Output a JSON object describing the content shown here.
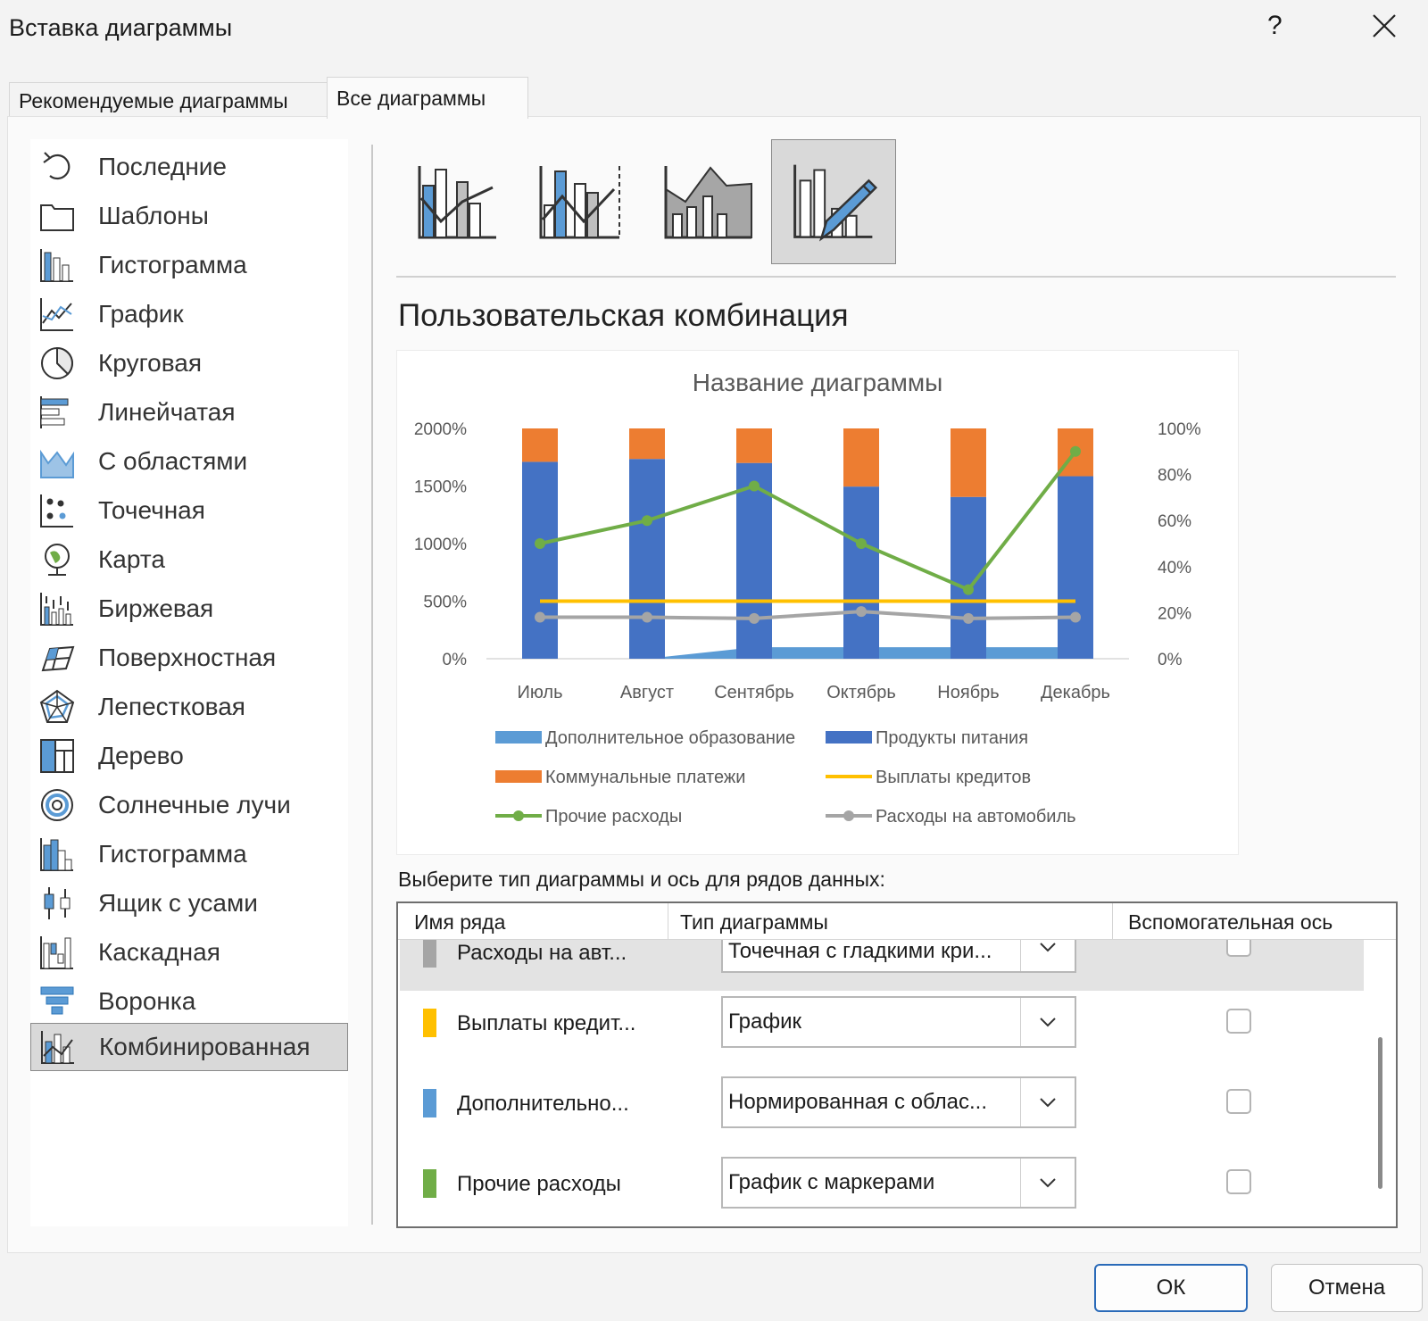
{
  "window": {
    "title": "Вставка диаграммы",
    "help": "?"
  },
  "tabs": [
    {
      "label": "Рекомендуемые диаграммы"
    },
    {
      "label": "Все диаграммы"
    }
  ],
  "sidebar": {
    "items": [
      {
        "label": "Последние",
        "icon": "recent-icon"
      },
      {
        "label": "Шаблоны",
        "icon": "templates-icon"
      },
      {
        "label": "Гистограмма",
        "icon": "column-chart-icon"
      },
      {
        "label": "График",
        "icon": "line-chart-icon"
      },
      {
        "label": "Круговая",
        "icon": "pie-chart-icon"
      },
      {
        "label": "Линейчатая",
        "icon": "bar-chart-icon"
      },
      {
        "label": "С областями",
        "icon": "area-chart-icon"
      },
      {
        "label": "Точечная",
        "icon": "scatter-chart-icon"
      },
      {
        "label": "Карта",
        "icon": "map-chart-icon"
      },
      {
        "label": "Биржевая",
        "icon": "stock-chart-icon"
      },
      {
        "label": "Поверхностная",
        "icon": "surface-chart-icon"
      },
      {
        "label": "Лепестковая",
        "icon": "radar-chart-icon"
      },
      {
        "label": "Дерево",
        "icon": "treemap-icon"
      },
      {
        "label": "Солнечные лучи",
        "icon": "sunburst-icon"
      },
      {
        "label": "Гистограмма",
        "icon": "histogram-icon"
      },
      {
        "label": "Ящик с усами",
        "icon": "box-whisker-icon"
      },
      {
        "label": "Каскадная",
        "icon": "waterfall-icon"
      },
      {
        "label": "Воронка",
        "icon": "funnel-icon"
      },
      {
        "label": "Комбинированная",
        "icon": "combo-chart-icon",
        "selected": true
      }
    ]
  },
  "subtypes": [
    {
      "icon": "clustered-column-line-icon"
    },
    {
      "icon": "clustered-column-line-secondary-axis-icon"
    },
    {
      "icon": "stacked-area-clustered-column-icon"
    },
    {
      "icon": "custom-combination-icon",
      "selected": true
    }
  ],
  "main": {
    "subtype_title": "Пользовательская комбинация",
    "series_prompt": "Выберите тип диаграммы и ось для рядов данных:"
  },
  "chart_data": {
    "type": "bar",
    "title": "Название диаграммы",
    "categories": [
      "Июль",
      "Август",
      "Сентябрь",
      "Октябрь",
      "Ноябрь",
      "Декабрь"
    ],
    "y_ticks": [
      "2000%",
      "1500%",
      "1000%",
      "500%",
      "0%"
    ],
    "y2_ticks": [
      "100%",
      "80%",
      "60%",
      "40%",
      "20%",
      "0%"
    ],
    "ylim": [
      0,
      2000
    ],
    "y2lim": [
      0,
      100
    ],
    "legend_position": "bottom",
    "series": [
      {
        "name": "Дополнительное образование",
        "kind": "area",
        "axis": "primary",
        "color": "#5b9bd5",
        "values": [
          0,
          0,
          100,
          100,
          100,
          100
        ]
      },
      {
        "name": "Продукты питания",
        "kind": "stacked-column",
        "axis": "primary",
        "color": "#4472c4",
        "values": [
          1710,
          1735,
          1700,
          1495,
          1405,
          1585
        ]
      },
      {
        "name": "Коммунальные платежи",
        "kind": "stacked-column",
        "axis": "primary",
        "color": "#ed7d31",
        "values": [
          290,
          265,
          300,
          505,
          595,
          415
        ]
      },
      {
        "name": "Выплаты кредитов",
        "kind": "line",
        "axis": "primary",
        "color": "#ffc000",
        "values": [
          500,
          500,
          500,
          500,
          500,
          500
        ]
      },
      {
        "name": "Прочие расходы",
        "kind": "line-markers",
        "axis": "secondary",
        "color": "#70ad47",
        "values": [
          50,
          60,
          75,
          50,
          30,
          90
        ]
      },
      {
        "name": "Расходы на автомобиль",
        "kind": "line-markers",
        "axis": "primary",
        "color": "#a5a5a5",
        "values": [
          360,
          360,
          350,
          410,
          350,
          360
        ]
      }
    ]
  },
  "series_table": {
    "headers": [
      "Имя ряда",
      "Тип диаграммы",
      "Вспомогательная ось"
    ],
    "rows": [
      {
        "name": "Расходы на авт...",
        "type": "Точечная с гладкими кри...",
        "color": "#a5a5a5",
        "secondary": false,
        "selected": true
      },
      {
        "name": "Выплаты кредит...",
        "type": "График",
        "color": "#ffc000",
        "secondary": false
      },
      {
        "name": "Дополнительно...",
        "type": "Нормированная с облас...",
        "color": "#5b9bd5",
        "secondary": false
      },
      {
        "name": "Прочие расходы",
        "type": "График с маркерами",
        "color": "#70ad47",
        "secondary": false
      }
    ]
  },
  "buttons": {
    "ok": "ОК",
    "cancel": "Отмена"
  }
}
